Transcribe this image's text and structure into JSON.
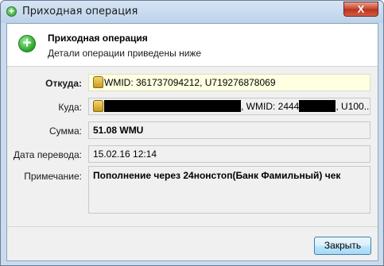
{
  "window": {
    "title": "Приходная операция",
    "close_glyph": "X"
  },
  "header": {
    "title": "Приходная операция",
    "subtitle": "Детали операции приведены ниже"
  },
  "fields": {
    "from_label": "Откуда:",
    "from_value": "WMID: 361737094212, U719276878069",
    "to_label": "Куда:",
    "to_wmid_prefix": ", WMID: 2444",
    "to_suffix": ", U100...",
    "amount_label": "Сумма:",
    "amount_value": "51.08 WMU",
    "date_label": "Дата перевода:",
    "date_value": "15.02.16 12:14",
    "note_label": "Примечание:",
    "note_value": "Пополнение через 24нонстоп(Банк Фамильный) чек"
  },
  "footer": {
    "close_button": "Закрыть"
  },
  "icons": {
    "title": "add-circle-icon",
    "header": "add-circle-icon",
    "wallet": "webmoney-passport-icon"
  },
  "colors": {
    "header_icon": "#27a227",
    "highlight_field": "#ffffe1",
    "close_button_border": "#3c7fb1"
  }
}
